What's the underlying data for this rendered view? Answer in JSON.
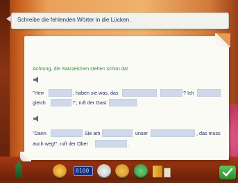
{
  "banner": {
    "instruction": "Schreibe die fehlenden Wörter in die Lücken."
  },
  "exercise": {
    "hint": "Achtung, die Satzzeichen stehen schon da!",
    "sentence1": {
      "p1": "\"Herr",
      "p2": ", haben sie was, das",
      "p3": "? Ich",
      "p4": "gleich",
      "p5": "!\", ruft der Gast",
      "p6": "."
    },
    "sentence2": {
      "p1": "\"Dann",
      "p2": "Sie am",
      "p3": "unser",
      "p4": ", das muss",
      "p5": "auch weg!\", ruft der Ober",
      "p6": "."
    }
  },
  "toolbar": {
    "clock_display": "0100"
  },
  "colors": {
    "gap_fill": "#cfd9ea",
    "hint_text": "#2f8a2f",
    "body_text": "#1f2b5a",
    "paper": "#fbfbf6"
  }
}
